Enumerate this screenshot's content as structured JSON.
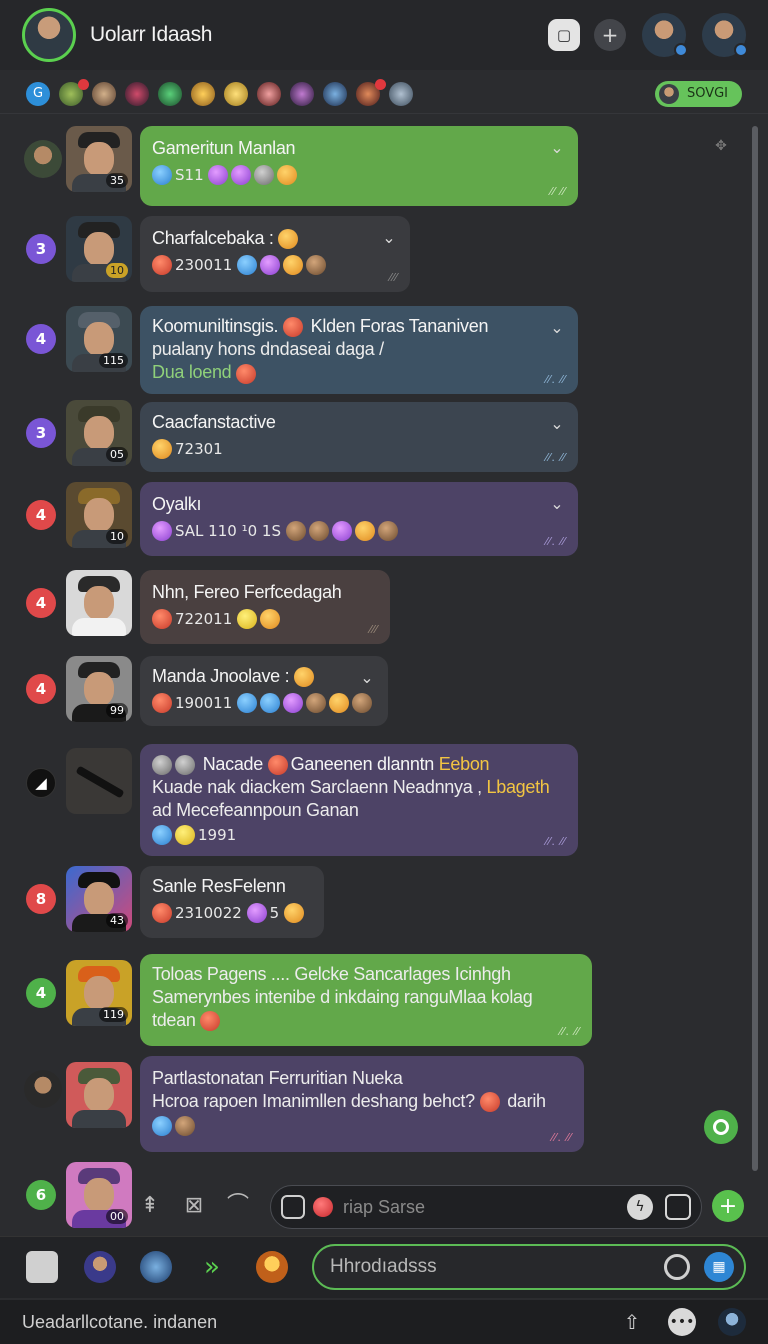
{
  "header": {
    "title": "Uolarr Idaash",
    "icons": [
      "square-button-icon",
      "plus-icon"
    ]
  },
  "strip": {
    "online_label": "SOVGI",
    "first_chip": "G"
  },
  "chats": [
    {
      "num": "",
      "name": "Gameritun Manlan",
      "lvl": "35",
      "meta": "S11",
      "color": "green"
    },
    {
      "num": "3",
      "name": "Charfalcebaka :",
      "lvl": "10",
      "meta": "230011",
      "color": "dark"
    },
    {
      "num": "4",
      "name": "Koomuniltinsgis.",
      "name_rest": "Klden Foras Tananiven",
      "line2": "pualany hons dndaseai daga /",
      "line3": "Dua loend",
      "lvl": "115",
      "color": "blue"
    },
    {
      "num": "3",
      "name": "Caacfanstactive",
      "lvl": "05",
      "meta": "72301",
      "color": "slate"
    },
    {
      "num": "4",
      "name": "Oyalkı",
      "lvl": "10",
      "meta": "SAL 110 ¹0 1S",
      "color": "purple"
    },
    {
      "num": "4",
      "name": "Nhn, Fereo Ferfcedagah",
      "lvl": "",
      "meta": "722011",
      "color": "brown"
    },
    {
      "num": "4",
      "name": "Manda Jnoolave :",
      "lvl": "99",
      "meta": "190011",
      "color": "dark"
    },
    {
      "num": "",
      "name": "Nacade",
      "name_rest": "Ganeenen dlanntn",
      "hl1": "Eebon",
      "line2": "Kuade nak diackem Sarclaenn Neadnnya ,",
      "hl2": "Lbageth",
      "line3": "ad Mecefeannpoun Ganan",
      "meta": "1991",
      "color": "purple"
    },
    {
      "num": "8",
      "name": "Sanle ResFelenn",
      "lvl": "43",
      "meta": "2310022",
      "meta2": "5",
      "color": "dark"
    },
    {
      "num": "4",
      "name": "Toloas Pagens .... Gelcke Sancarlages Icinhgh",
      "line2": "Samerynbes intenibe d inkdaing rangu",
      "line2b": "Mlaa kolag",
      "line3": "tdean",
      "lvl": "119",
      "color": "green"
    },
    {
      "num": "",
      "name": "Partlastonatan Ferruritian Nueka",
      "line2": "Hcroa rapoen Imanimllen deshang behct?",
      "line2b": "darih",
      "color": "purple"
    },
    {
      "num": "6",
      "lvl": "00"
    }
  ],
  "composer": {
    "placeholder": "riap Sarse"
  },
  "bottom": {
    "search_placeholder": "Hhrodıadsss"
  },
  "status": {
    "text": "Ueadarllcotane. indanen"
  },
  "colors": {
    "accent_green": "#5bd04f",
    "bubble_green": "#62a84a",
    "badge_purple": "#7a56d6",
    "badge_red": "#e0494a"
  }
}
